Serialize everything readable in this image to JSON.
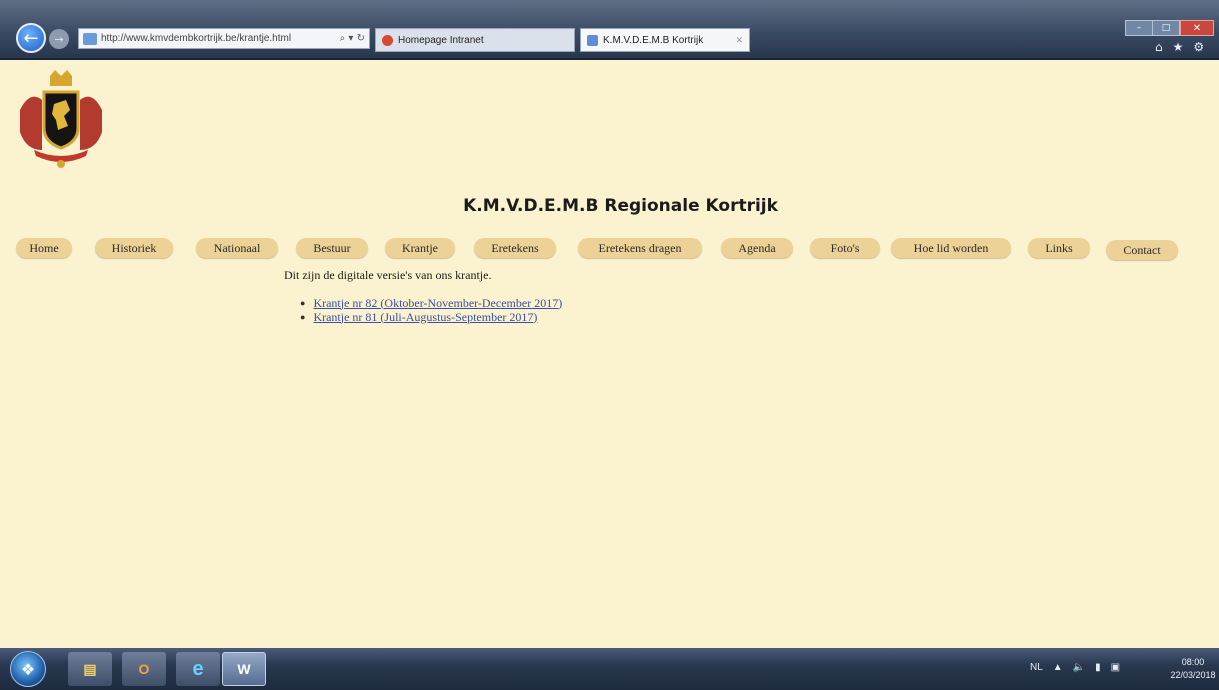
{
  "browser": {
    "address": "http://www.kmvdembkortrijk.be/krantje.html",
    "address_controls": "⌕ ▾ ↻",
    "tabs": [
      {
        "label": "Homepage Intranet"
      },
      {
        "label": "K.M.V.D.E.M.B Kortrijk"
      }
    ],
    "tab_close": "✕",
    "window_controls": {
      "minimize": "–",
      "maximize": "□",
      "close": "✕"
    }
  },
  "page": {
    "title": "K.M.V.D.E.M.B Regionale Kortrijk",
    "nav": [
      "Home",
      "Historiek",
      "Nationaal",
      "Bestuur",
      "Krantje",
      "Eretekens",
      "Eretekens dragen",
      "Agenda",
      "Foto's",
      "Hoe lid worden",
      "Links",
      "Contact"
    ],
    "intro": "Dit zijn de digitale versie's van ons krantje.",
    "links": [
      "Krantje nr 82 (Oktober-November-December 2017)",
      "Krantje nr 81 (Juli-Augustus-September 2017)"
    ]
  },
  "taskbar": {
    "word_label": "W",
    "outlook_label": "O",
    "ie_label": "e",
    "tray": {
      "language": "NL"
    },
    "clock": {
      "time": "08:00",
      "date": "22/03/2018"
    }
  }
}
